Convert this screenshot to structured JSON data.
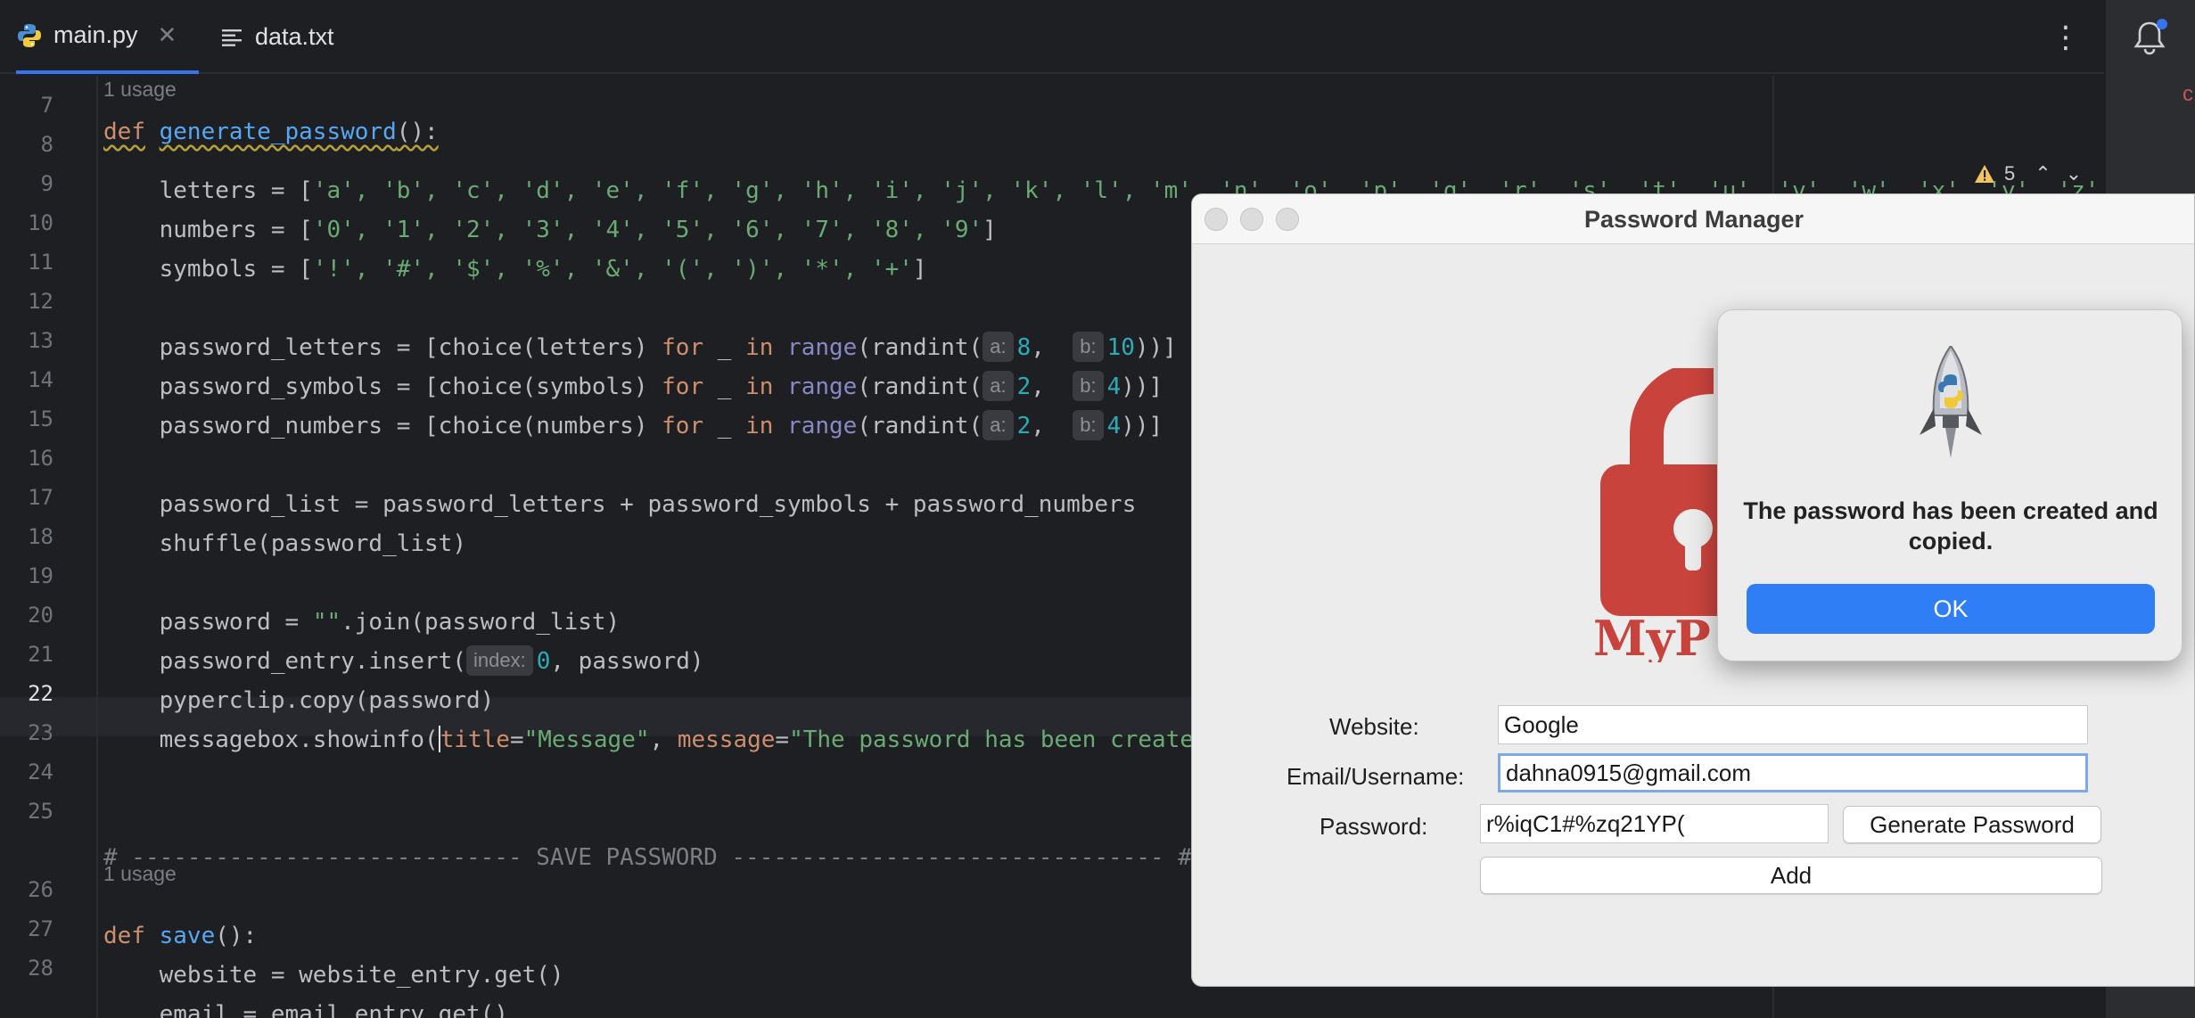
{
  "tabs": [
    {
      "label": "main.py",
      "icon": "python-file-icon",
      "active": true
    },
    {
      "label": "data.txt",
      "icon": "text-file-icon",
      "active": false
    }
  ],
  "editor": {
    "usage_label": "1 usage",
    "warnings_count": "5",
    "line_numbers": [
      "7",
      "8",
      "9",
      "10",
      "11",
      "12",
      "13",
      "14",
      "15",
      "16",
      "17",
      "18",
      "19",
      "20",
      "21",
      "22",
      "23",
      "24",
      "25",
      "26",
      "27",
      "28"
    ],
    "active_line": "22",
    "code": {
      "l7_kw": "def",
      "l7_fn": "generate_password",
      "l7_rest": "():",
      "l8": "    letters = [",
      "l8_items": "'a', 'b', 'c', 'd', 'e', 'f', 'g', 'h', 'i', 'j', 'k', 'l', 'm', 'n', 'o', 'p', 'q', 'r', 's', 't', 'u', ",
      "l8_v": "'v'",
      "l8_tail": ", 'w', 'x', 'y', 'z',",
      "l9": "    numbers = [",
      "l9_items": "'0', '1', '2', '3', '4', '5', '6', '7', '8', '9'",
      "l9_end": "]",
      "l10": "    symbols = [",
      "l10_items": "'!', '#', '$', '%', '&', '(', ')', '*', '+'",
      "l10_end": "]",
      "l12_a": "    password_letters = [choice(letters) ",
      "l13_a": "    password_symbols = [choice(symbols) ",
      "l14_a": "    password_numbers = [choice(numbers) ",
      "kw_for": "for",
      "kw_in": "in",
      "us": " _ ",
      "bi_range": "range",
      "randint": "(randint(",
      "hint_a": "a:",
      "hint_b": "b:",
      "l12_n1": "8",
      "l12_n2": "10",
      "l13_n1": "2",
      "l13_n2": "4",
      "l14_n1": "2",
      "l14_n2": "4",
      "close2": "))]",
      "comma": ",",
      "l16": "    password_list = password_letters + password_symbols + password_numbers",
      "l17": "    shuffle(password_list)",
      "l19_a": "    password = ",
      "l19_str": "\"\"",
      "l19_b": ".join(password_list)",
      "l20_a": "    password_entry.insert(",
      "l20_hint": "index:",
      "l20_num": "0",
      "l20_b": ", password)",
      "l21": "    pyperclip.copy(password)",
      "l22_a": "    messagebox.showinfo(",
      "l22_p1": "title",
      "l22_eq": "=",
      "l22_s1": "\"Message\"",
      "l22_comma": ", ",
      "l22_p2": "message",
      "l22_s2": "\"The password has been create",
      "l25": "# ---------------------------- SAVE PASSWORD ------------------------------- #",
      "l26_kw": "def",
      "l26_fn": "save",
      "l26_rest": "():",
      "l27": "    website = website_entry.get()",
      "l28": "    email = email_entry.get()"
    }
  },
  "app_window": {
    "title": "Password Manager",
    "logo_text": "MyP",
    "website_label": "Website:",
    "website_value": "Google",
    "email_label": "Email/Username:",
    "email_value": "dahna0915@gmail.com",
    "password_label": "Password:",
    "password_value": "r%iqC1#%zq21YP(",
    "generate_button": "Generate Password",
    "add_button": "Add",
    "logo_color": "#c9433d"
  },
  "alert": {
    "message": "The password has been created and copied.",
    "ok_label": "OK",
    "icon": "python-launcher-rocket-icon",
    "button_color": "#2f7ef6"
  },
  "edge_glyph": "c"
}
